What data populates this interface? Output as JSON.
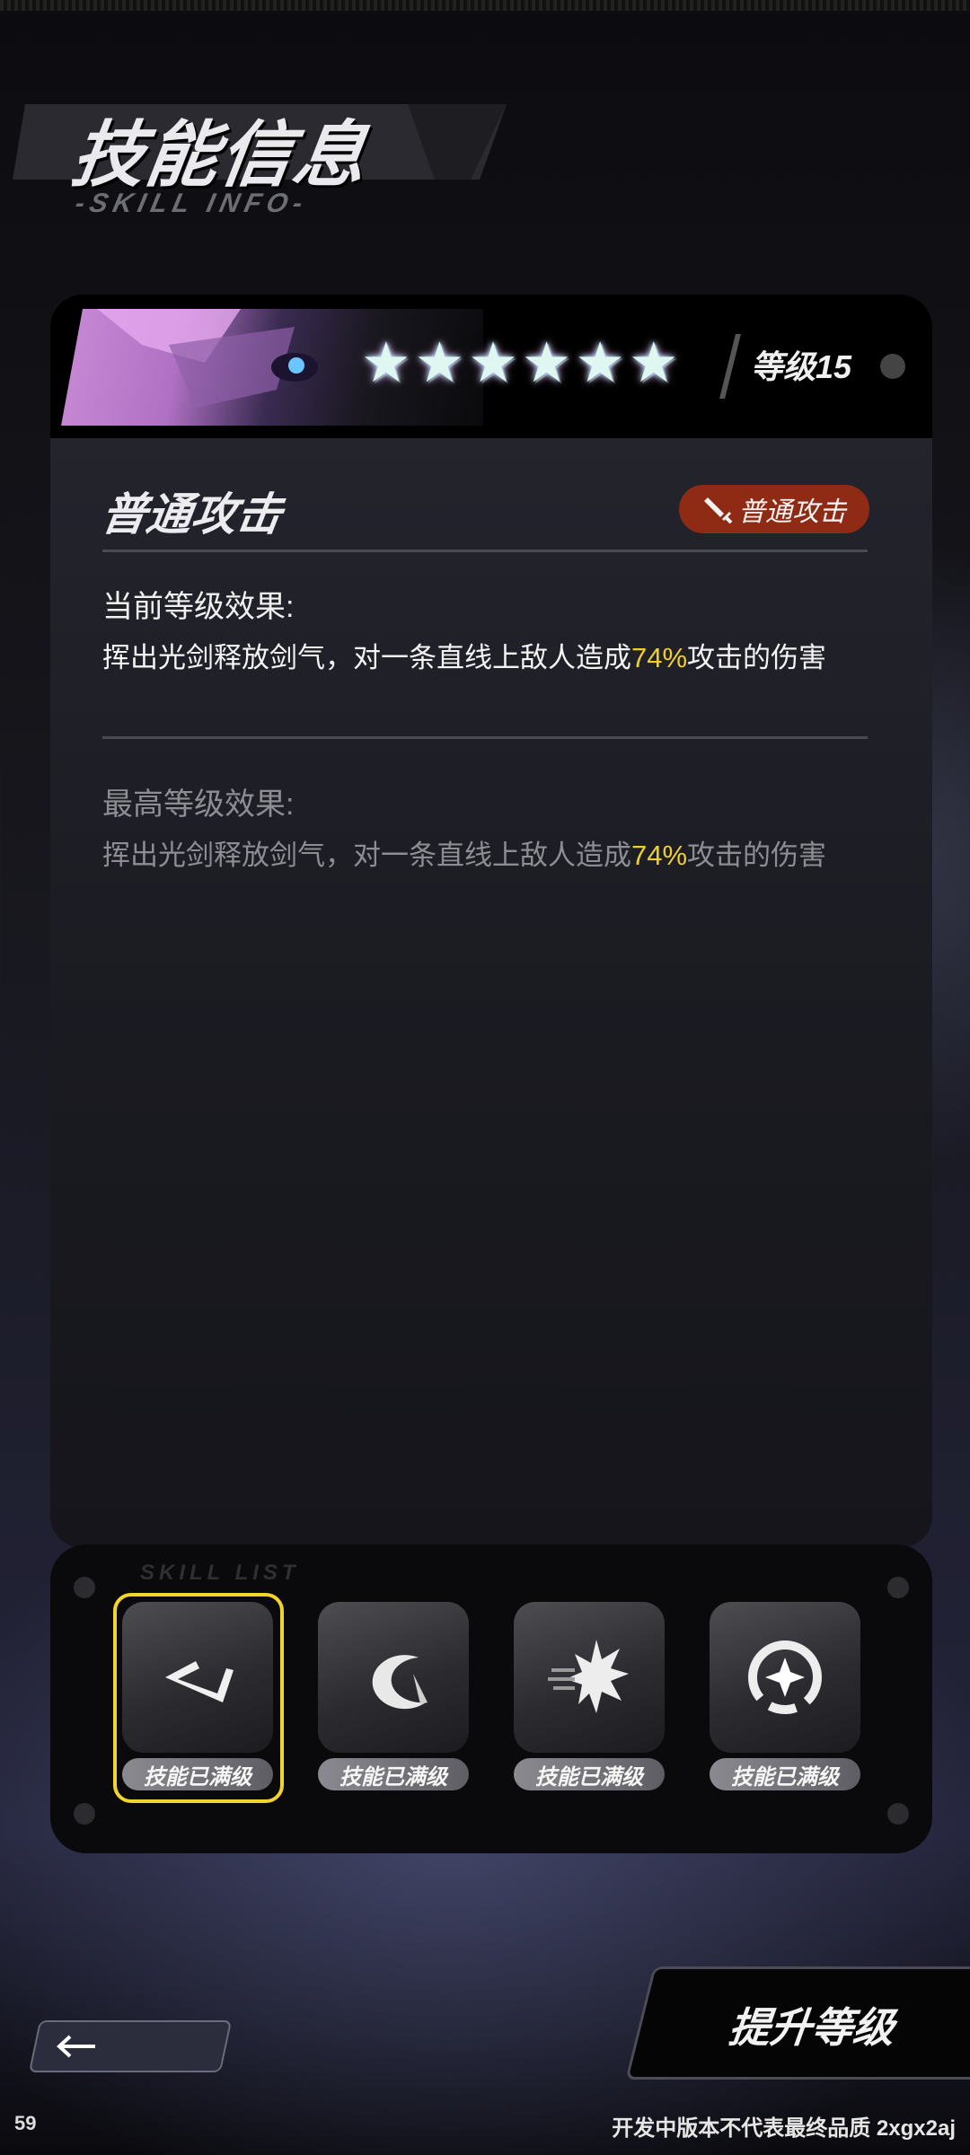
{
  "page": {
    "title": "技能信息",
    "subtitle": "-SKILL INFO-"
  },
  "skill": {
    "stars": [
      "★",
      "★",
      "★",
      "★",
      "★",
      "★"
    ],
    "level_label": "等级15",
    "name": "普通攻击",
    "type_badge": "普通攻击",
    "current": {
      "title": "当前等级效果:",
      "text_before": "挥出光剑释放剑气，对一条直线上敌人造成",
      "highlight": "74%",
      "text_after": "攻击的伤害"
    },
    "max": {
      "title": "最高等级效果:",
      "text_before": "挥出光剑释放剑气，对一条直线上敌人造成",
      "highlight": "74%",
      "text_after": "攻击的伤害"
    }
  },
  "skill_list": {
    "label": "SKILL LIST",
    "slots": [
      {
        "icon": "slash-icon",
        "status": "技能已满级",
        "selected": true
      },
      {
        "icon": "crescent-icon",
        "status": "技能已满级",
        "selected": false
      },
      {
        "icon": "burst-icon",
        "status": "技能已满级",
        "selected": false
      },
      {
        "icon": "target-icon",
        "status": "技能已满级",
        "selected": false
      }
    ]
  },
  "footer": {
    "upgrade_button": "提升等级",
    "fps": "59",
    "notice": "开发中版本不代表最终品质 2xgx2aj"
  },
  "colors": {
    "highlight": "#f2cf28",
    "badge_bg": "#8f2a14",
    "selected_border": "#f2d42a"
  }
}
